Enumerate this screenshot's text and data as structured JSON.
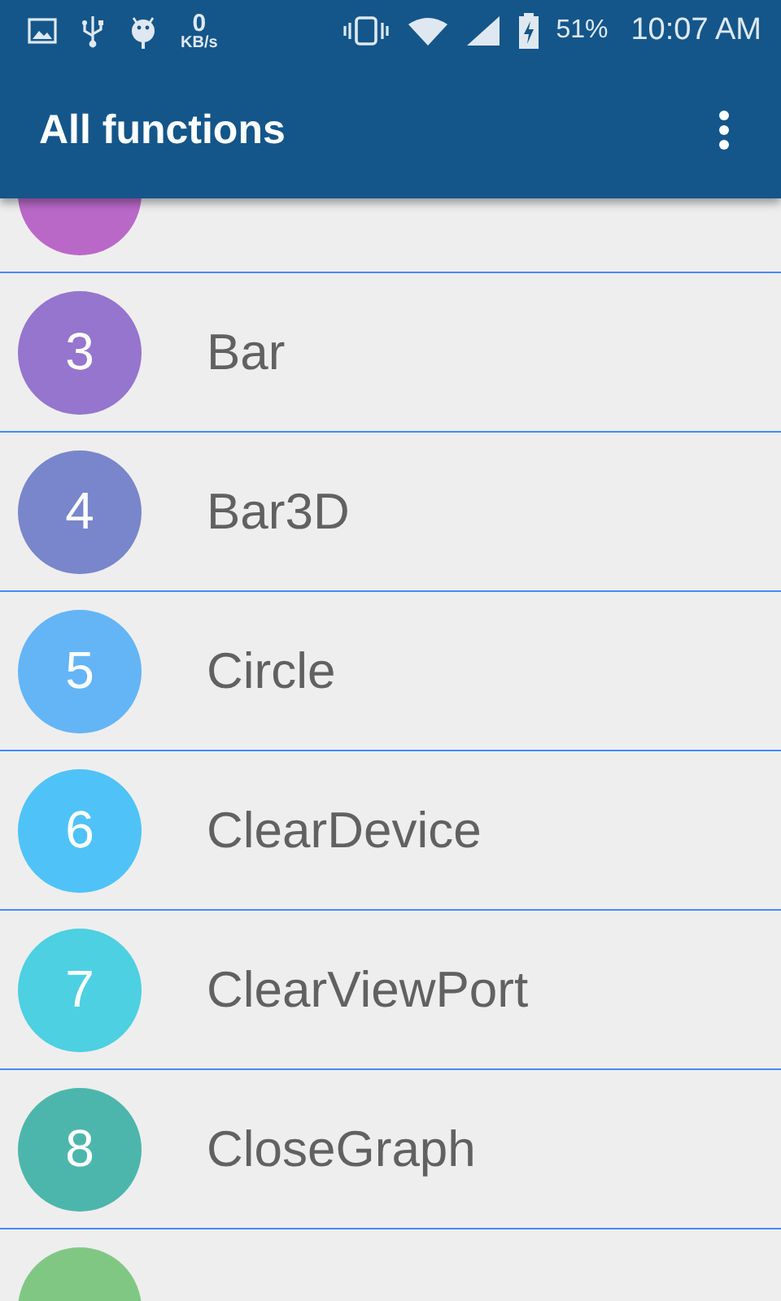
{
  "status_bar": {
    "speed_value": "0",
    "speed_unit": "KB/s",
    "battery": "51%",
    "time": "10:07 AM"
  },
  "toolbar": {
    "title": "All functions"
  },
  "items": [
    {
      "color": "#ba68c8"
    },
    {
      "number": "3",
      "name": "Bar",
      "color": "#9575cd"
    },
    {
      "number": "4",
      "name": "Bar3D",
      "color": "#7986cb"
    },
    {
      "number": "5",
      "name": "Circle",
      "color": "#64b5f6"
    },
    {
      "number": "6",
      "name": "ClearDevice",
      "color": "#4fc3f7"
    },
    {
      "number": "7",
      "name": "ClearViewPort",
      "color": "#4dd0e1"
    },
    {
      "number": "8",
      "name": "CloseGraph",
      "color": "#4db6ac"
    },
    {
      "color": "#81c784"
    }
  ]
}
